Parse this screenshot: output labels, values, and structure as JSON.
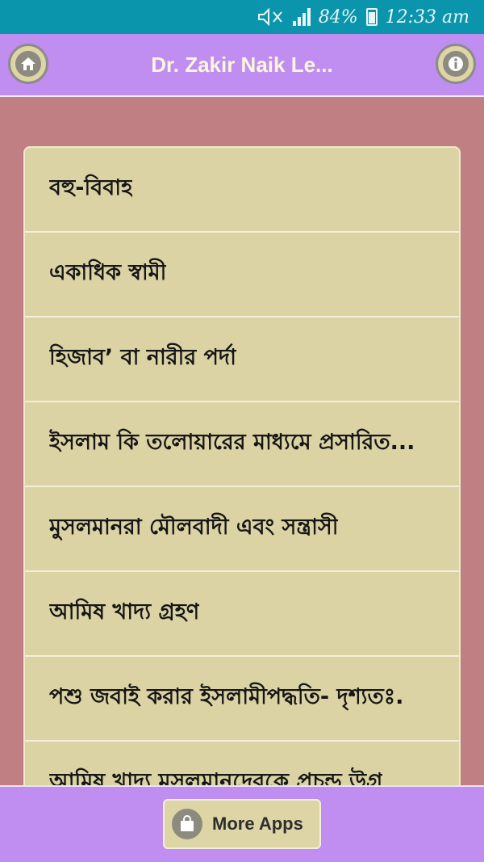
{
  "status_bar": {
    "battery": "84%",
    "time": "12:33 am"
  },
  "app_bar": {
    "title": "Dr. Zakir Naik Le...",
    "home_icon": "home-icon",
    "info_icon": "info-icon"
  },
  "list": {
    "items": [
      {
        "label": "বহু-বিবাহ"
      },
      {
        "label": "একাধিক স্বামী"
      },
      {
        "label": "হিজাব’ বা নারীর পর্দা"
      },
      {
        "label": "ইসলাম কি তলোয়ারের মাধ্যমে প্রসারিত..."
      },
      {
        "label": "মুসলমানরা মৌলবাদী এবং সন্ত্রাসী"
      },
      {
        "label": "আমিষ খাদ্য গ্রহণ"
      },
      {
        "label": "পশু জবাই করার ইসলামীপদ্ধতি- দৃশ্যতঃ."
      },
      {
        "label": "আমিষ খাদ্য মুসলমানদেরকে প্রচন্ড উগ্র"
      }
    ]
  },
  "bottom_bar": {
    "more_apps_label": "More Apps",
    "bag_icon": "shopping-bag-icon"
  },
  "colors": {
    "status_bar": "#0a95ad",
    "app_bar": "#c08df1",
    "background": "#c07f82",
    "list_item": "#dcd3a4",
    "button_face": "#ddd5a6",
    "icon_fill": "#8d8a80"
  }
}
